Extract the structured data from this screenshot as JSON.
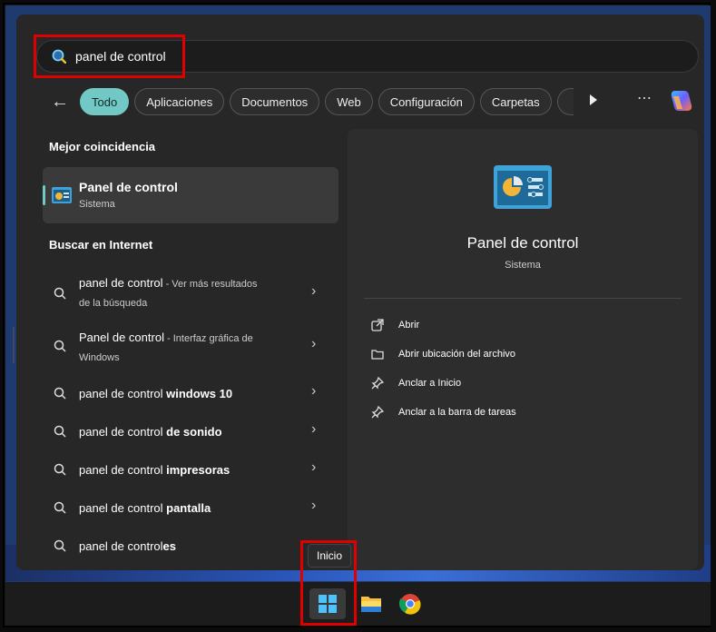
{
  "search": {
    "value": "panel de control"
  },
  "filters": [
    "Todo",
    "Aplicaciones",
    "Documentos",
    "Web",
    "Configuración",
    "Carpetas"
  ],
  "best_match": {
    "section_title": "Mejor coincidencia",
    "name": "Panel de control",
    "subtitle": "Sistema"
  },
  "web": {
    "section_title": "Buscar en Internet",
    "results": [
      {
        "query": "panel de control",
        "bold": "",
        "desc": " - Ver más resultados",
        "desc2": "de la búsqueda"
      },
      {
        "query": "Panel de control",
        "bold": "",
        "desc": " - Interfaz gráfica de",
        "desc2": "Windows"
      },
      {
        "query": "panel de control ",
        "bold": "windows 10",
        "desc": "",
        "desc2": ""
      },
      {
        "query": "panel de control ",
        "bold": "de sonido",
        "desc": "",
        "desc2": ""
      },
      {
        "query": "panel de control ",
        "bold": "impresoras",
        "desc": "",
        "desc2": ""
      },
      {
        "query": "panel de control ",
        "bold": "pantalla",
        "desc": "",
        "desc2": ""
      },
      {
        "query": "panel de control",
        "bold": "es",
        "desc": "",
        "desc2": ""
      }
    ]
  },
  "details": {
    "title": "Panel de control",
    "subtitle": "Sistema",
    "actions": [
      "Abrir",
      "Abrir ubicación del archivo",
      "Anclar a Inicio",
      "Anclar a la barra de tareas"
    ]
  },
  "tooltip": "Inicio",
  "colors": {
    "accent": "#72c8c4",
    "highlight": "#e00000"
  }
}
